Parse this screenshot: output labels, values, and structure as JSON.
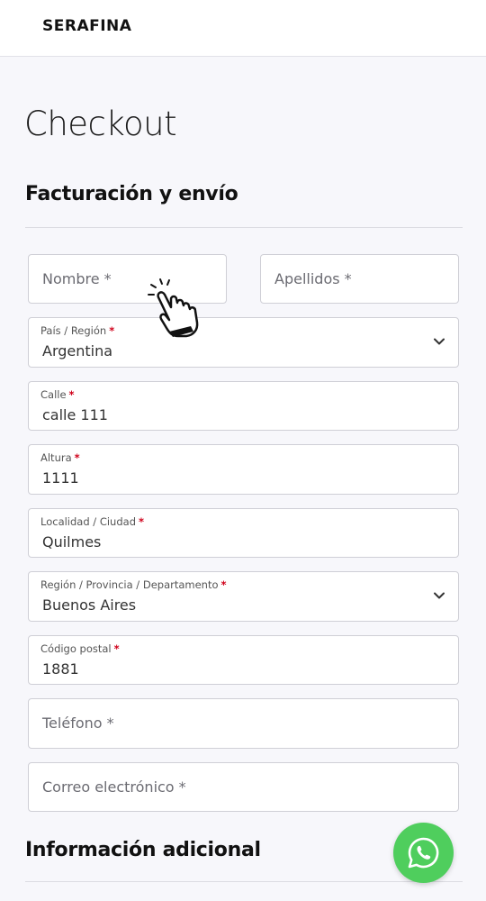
{
  "header": {
    "brand": "SERAFINA"
  },
  "page": {
    "title": "Checkout"
  },
  "billing": {
    "title": "Facturación y envío",
    "first_name": {
      "placeholder": "Nombre *"
    },
    "last_name": {
      "placeholder": "Apellidos *"
    },
    "country": {
      "label": "País / Región",
      "value": "Argentina"
    },
    "street": {
      "label": "Calle",
      "value": "calle 111"
    },
    "number": {
      "label": "Altura",
      "value": "1111"
    },
    "city": {
      "label": "Localidad / Ciudad",
      "value": "Quilmes"
    },
    "state": {
      "label": "Región / Provincia / Departamento",
      "value": "Buenos Aires"
    },
    "postcode": {
      "label": "Código postal",
      "value": "1881"
    },
    "phone": {
      "placeholder": "Teléfono *"
    },
    "email": {
      "placeholder": "Correo electrónico *"
    },
    "required_mark": "*"
  },
  "additional": {
    "title": "Información adicional"
  },
  "icons": {
    "pointer": "hand-pointer-icon",
    "chat": "whatsapp-icon",
    "dropdown": "chevron-down-icon"
  },
  "colors": {
    "background": "#f7f7fb",
    "required": "#d0021b",
    "whatsapp": "#4fce5d"
  }
}
